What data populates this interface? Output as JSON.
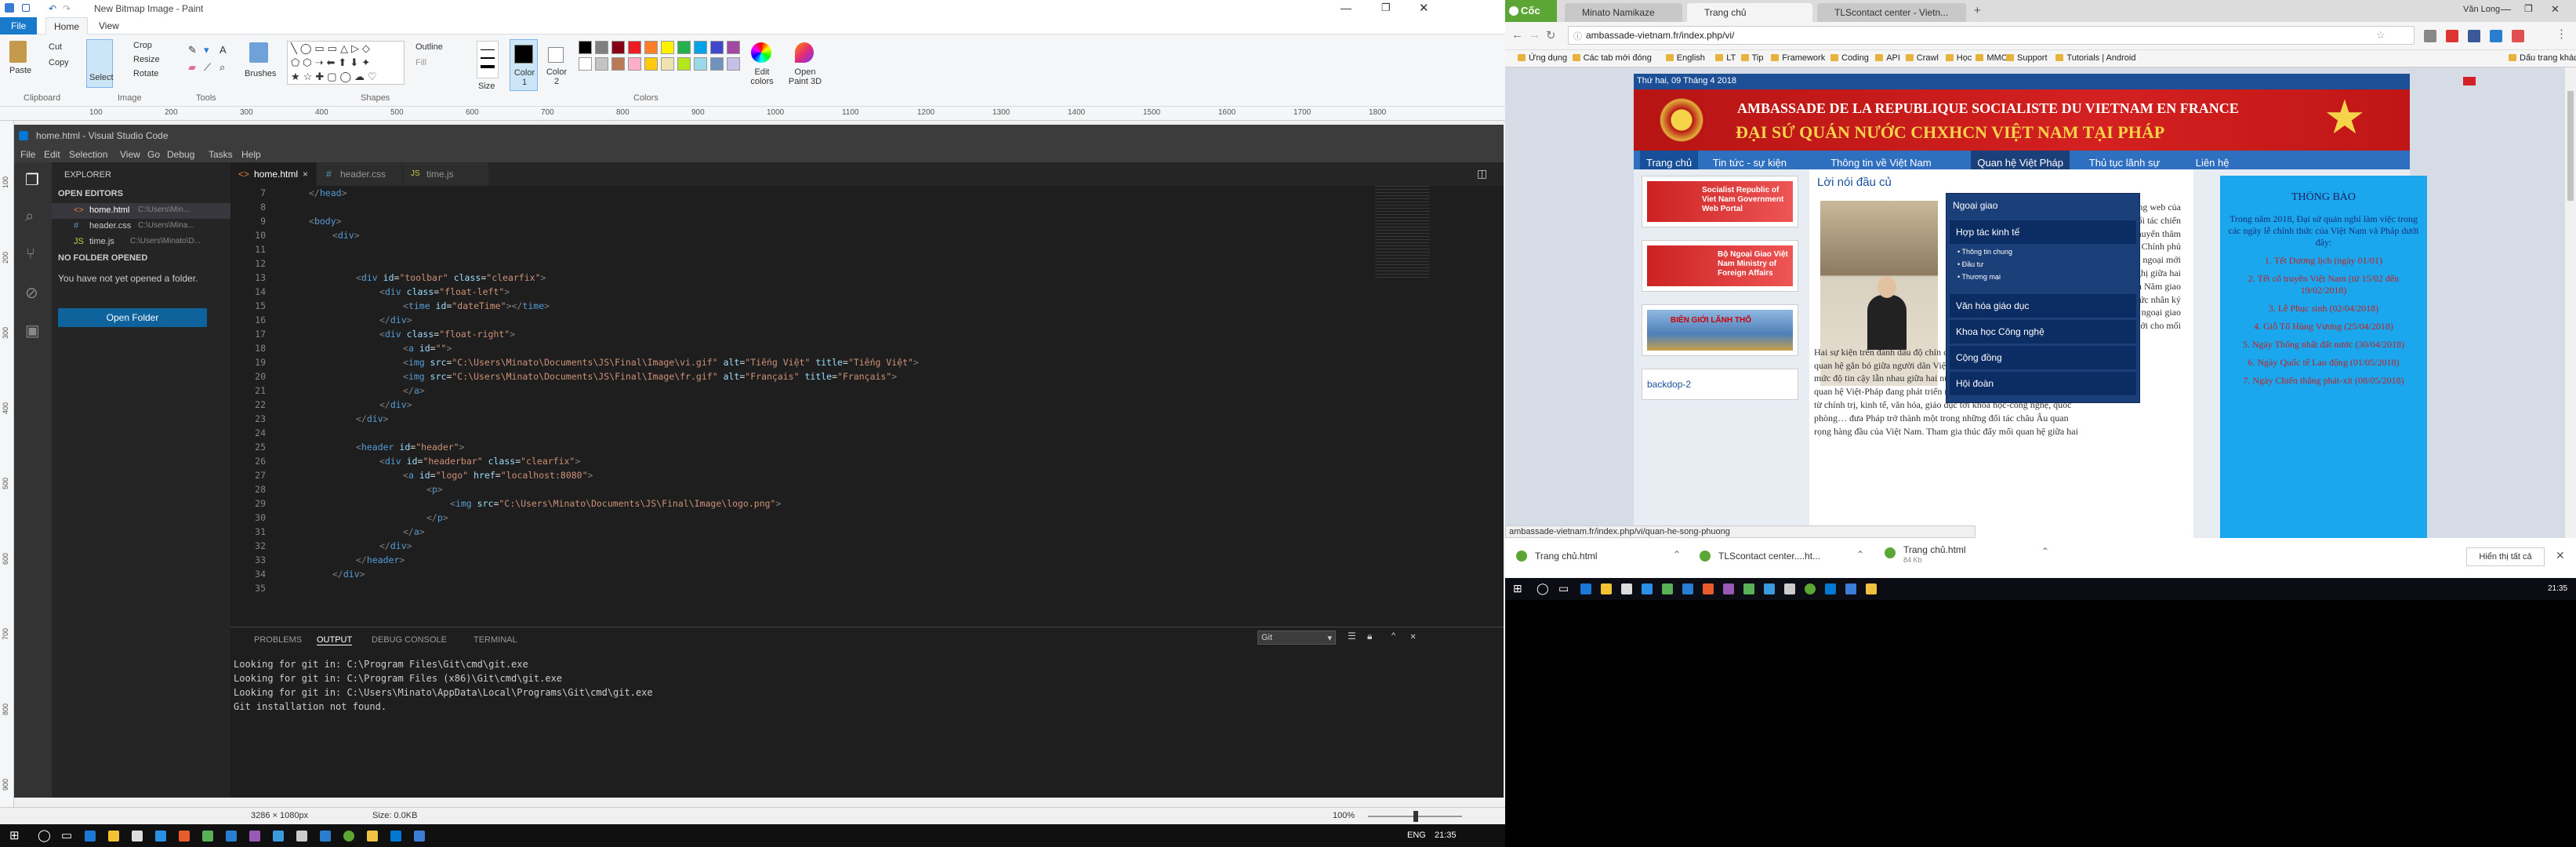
{
  "paint": {
    "title": "New Bitmap Image - Paint",
    "file_tab": "File",
    "tabs": [
      "Home",
      "View"
    ],
    "clipboard": {
      "paste": "Paste",
      "cut": "Cut",
      "copy": "Copy",
      "group": "Clipboard"
    },
    "image": {
      "select": "Select",
      "crop": "Crop",
      "resize": "Resize",
      "rotate": "Rotate",
      "group": "Image"
    },
    "tools_group": "Tools",
    "brushes": "Brushes",
    "shapes": {
      "outline": "Outline",
      "fill": "Fill",
      "group": "Shapes"
    },
    "size": "Size",
    "color1": "Color 1",
    "color2": "Color 2",
    "colors_group": "Colors",
    "edit_colors": "Edit colors",
    "open_paint3d": "Open Paint 3D",
    "ruler_ticks": [
      "100",
      "200",
      "300",
      "400",
      "500",
      "600",
      "700",
      "800",
      "900",
      "1000",
      "1100",
      "1200",
      "1300",
      "1400",
      "1500",
      "1600",
      "1700",
      "1800"
    ],
    "vruler_ticks": [
      "100",
      "200",
      "300",
      "400",
      "500",
      "600",
      "700",
      "800",
      "900"
    ],
    "status": {
      "dimensions": "3286 × 1080px",
      "size": "Size: 0.0KB",
      "zoom": "100%"
    },
    "palette": [
      "#000000",
      "#7f7f7f",
      "#880015",
      "#ed1c24",
      "#ff7f27",
      "#fff200",
      "#22b14c",
      "#00a2e8",
      "#3f48cc",
      "#a349a4",
      "#ffffff",
      "#c3c3c3",
      "#b97a57",
      "#ffaec9",
      "#ffc90e",
      "#efe4b0",
      "#b5e61d",
      "#99d9ea",
      "#7092be",
      "#c8bfe7"
    ]
  },
  "vscode": {
    "title": "home.html - Visual Studio Code",
    "menu": [
      "File",
      "Edit",
      "Selection",
      "View",
      "Go",
      "Debug",
      "Tasks",
      "Help"
    ],
    "explorer_title": "EXPLORER",
    "open_editors": "OPEN EDITORS",
    "open_files": [
      {
        "name": "home.html",
        "path": "C:\\Users\\Min..."
      },
      {
        "name": "header.css",
        "path": "C:\\Users\\Mina..."
      },
      {
        "name": "time.js",
        "path": "C:\\Users\\Minato\\D..."
      }
    ],
    "no_folder": "NO FOLDER OPENED",
    "no_folder_msg": "You have not yet opened a folder.",
    "open_folder": "Open Folder",
    "tabs": [
      "home.html",
      "header.css",
      "time.js"
    ],
    "code_lines": [
      {
        "n": "7",
        "ind": 1,
        "html": "</head>"
      },
      {
        "n": "8",
        "ind": 0,
        "html": ""
      },
      {
        "n": "9",
        "ind": 1,
        "html": "<body>"
      },
      {
        "n": "10",
        "ind": 2,
        "html": "<div>"
      },
      {
        "n": "11",
        "ind": 0,
        "html": ""
      },
      {
        "n": "12",
        "ind": 0,
        "html": ""
      },
      {
        "n": "13",
        "ind": 3,
        "html": "<div id=\"toolbar\" class=\"clearfix\">"
      },
      {
        "n": "14",
        "ind": 4,
        "html": "<div class=\"float-left\">"
      },
      {
        "n": "15",
        "ind": 5,
        "html": "<time id=\"dateTime\"></time>"
      },
      {
        "n": "16",
        "ind": 4,
        "html": "</div>"
      },
      {
        "n": "17",
        "ind": 4,
        "html": "<div class=\"float-right\">"
      },
      {
        "n": "18",
        "ind": 5,
        "html": "<a id=\"\">"
      },
      {
        "n": "19",
        "ind": 5,
        "html": "<img src=\"C:\\Users\\Minato\\Documents\\JS\\Final\\Image\\vi.gif\" alt=\"Tiếng Việt\" title=\"Tiếng Việt\">"
      },
      {
        "n": "20",
        "ind": 5,
        "html": "<img src=\"C:\\Users\\Minato\\Documents\\JS\\Final\\Image\\fr.gif\" alt=\"Français\" title=\"Français\">"
      },
      {
        "n": "21",
        "ind": 5,
        "html": "</a>"
      },
      {
        "n": "22",
        "ind": 4,
        "html": "</div>"
      },
      {
        "n": "23",
        "ind": 3,
        "html": "</div>"
      },
      {
        "n": "24",
        "ind": 0,
        "html": ""
      },
      {
        "n": "25",
        "ind": 3,
        "html": "<header id=\"header\">"
      },
      {
        "n": "26",
        "ind": 4,
        "html": "<div id=\"headerbar\" class=\"clearfix\">"
      },
      {
        "n": "27",
        "ind": 5,
        "html": "<a id=\"logo\" href=\"localhost:8080\">"
      },
      {
        "n": "28",
        "ind": 6,
        "html": "<p>"
      },
      {
        "n": "29",
        "ind": 7,
        "html": "<img src=\"C:\\Users\\Minato\\Documents\\JS\\Final\\Image\\logo.png\">"
      },
      {
        "n": "30",
        "ind": 6,
        "html": "</p>"
      },
      {
        "n": "31",
        "ind": 5,
        "html": "</a>"
      },
      {
        "n": "32",
        "ind": 4,
        "html": "</div>"
      },
      {
        "n": "33",
        "ind": 3,
        "html": "</header>"
      },
      {
        "n": "34",
        "ind": 2,
        "html": "</div>"
      },
      {
        "n": "35",
        "ind": 0,
        "html": ""
      }
    ],
    "panel_tabs": [
      "PROBLEMS",
      "OUTPUT",
      "DEBUG CONSOLE",
      "TERMINAL"
    ],
    "panel_select": "Git",
    "output": [
      "Looking for git in: C:\\Program Files\\Git\\cmd\\git.exe",
      "Looking for git in: C:\\Program Files (x86)\\Git\\cmd\\git.exe",
      "Looking for git in: C:\\Users\\Minato\\AppData\\Local\\Programs\\Git\\cmd\\git.exe",
      "Git installation not found."
    ]
  },
  "taskbar_left": {
    "lang": "ENG",
    "time": "21:35"
  },
  "browser": {
    "brand": "Cốc Cốc",
    "tabs": [
      "Minato Namikaze",
      "Trang chủ",
      "TLScontact center - Vietn..."
    ],
    "url": "ambassade-vietnam.fr/index.php/vi/",
    "user": "Văn Long",
    "bookmarks": [
      "Ứng dụng",
      "Các tab mới đóng",
      "English",
      "LT",
      "Tip",
      "Framework",
      "Coding",
      "API",
      "Crawl",
      "Học",
      "MMO",
      "Support",
      "Tutorials | Android",
      "Dấu trang khác"
    ],
    "date_line": "Thứ hai, 09 Tháng 4 2018",
    "banner_title": "AMBASSADE DE LA REPUBLIQUE SOCIALISTE DU VIETNAM EN FRANCE",
    "banner_sub": "ĐẠI SỨ QUÁN NƯỚC CHXHCN VIỆT NAM TẠI PHÁP",
    "nav": [
      "Trang chủ",
      "Tin tức - sự kiện",
      "Thông tin về Việt Nam",
      "Quan hệ Việt Pháp",
      "Thủ tục lãnh sự",
      "Liên hệ"
    ],
    "dropdown": [
      "Ngoại giao",
      "Hợp tác kinh tế",
      "Văn hóa giáo dục",
      "Khoa học Công nghệ",
      "Cộng đồng",
      "Hội đoàn"
    ],
    "sub_items": [
      "Thông tin chung",
      "Đầu tư",
      "Thương mại"
    ],
    "article_title": "Lời nói đầu củ",
    "article_text": [
      "trang web của",
      "Đối tác chiến",
      "chuyến thăm",
      "Chính phủ",
      "ộc ngoại mới",
      "ghị giữa hai",
      "của Năm giao",
      "thức nhân kỷ",
      "ệ ngoại giao",
      "mới cho mối",
      "quan hệ song phương này.",
      "Hai sự kiện trên đánh dấu độ chín của mối",
      "quan hệ gắn bó giữa người dân Việt Nam và Pháp cũng như thể hiện",
      "mức độ tin cậy lẫn nhau giữa hai nước, tạo thêm sung lực mới cho",
      "quan hệ Việt-Pháp đang phát triển rất tốt đẹp trong tất cả các lĩnh vực",
      "từ chính trị, kinh tế, văn hóa, giáo dục tới khoa học-công nghệ, quốc",
      "phòng… đưa Pháp trở thành một trong những đối tác châu Âu quan",
      "rọng hàng đầu của Việt Nam. Tham gia thúc đẩy mối quan hệ giữa hai"
    ],
    "side_links": [
      "Socialist Republic of Viet Nam Government Web Portal",
      "Bộ Ngoại Giao Việt Nam Ministry of Foreign Affairs",
      "BIÊN GIỚI LÃNH THỔ"
    ],
    "backdop": "backdop-2",
    "notice_title": "THÔNG BÁO",
    "notice_intro": "Trong năm 2018, Đại sứ quán nghỉ làm việc trong các ngày lễ chính thức của Việt Nam và Pháp dưới đây:",
    "notice_items": [
      "1. Tết Dương lịch (ngày 01/01)",
      "2. Tết cổ truyền Việt Nam (từ 15/02 đến 19/02/2018)",
      "3. Lễ Phục sinh (02/04/2018)",
      "4. Giỗ Tổ Hùng Vương (25/04/2018)",
      "5. Ngày Thống nhất đất nước (30/04/2018)",
      "6. Ngày Quốc tế Lao động (01/05/2018)",
      "7. Ngày Chiến thắng phát-xít (08/05/2018)"
    ],
    "status_url": "ambassade-vietnam.fr/index.php/vi/quan-he-song-phuong",
    "downloads": [
      {
        "name": "Trang chủ.html",
        "sub": ""
      },
      {
        "name": "TLScontact center....ht...",
        "sub": ""
      },
      {
        "name": "Trang chủ.html",
        "sub": "84 Kb"
      }
    ],
    "show_all": "Hiển thị tất cả"
  },
  "taskbar_right": {
    "time": "21:35"
  }
}
